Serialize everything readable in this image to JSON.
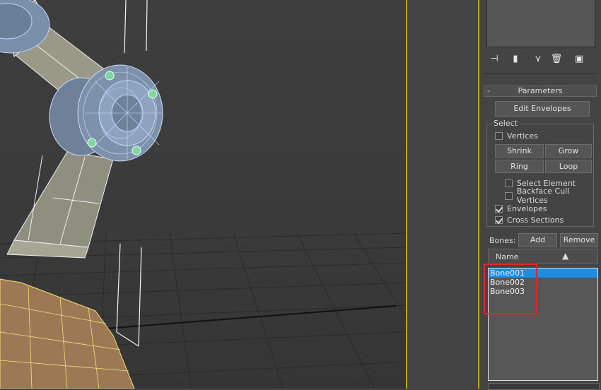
{
  "panel": {
    "rollout_title": "Parameters",
    "collapse_symbol": "-",
    "edit_envelopes": "Edit Envelopes",
    "select_group_label": "Select",
    "vertices": {
      "label": "Vertices",
      "checked": false
    },
    "shrink": "Shrink",
    "grow": "Grow",
    "ring": "Ring",
    "loop": "Loop",
    "select_element": {
      "label": "Select Element",
      "checked": false
    },
    "backface_cull": {
      "label": "Backface Cull Vertices",
      "checked": false
    },
    "envelopes": {
      "label": "Envelopes",
      "checked": true
    },
    "cross_sections": {
      "label": "Cross Sections",
      "checked": true
    },
    "bones_label": "Bones:",
    "add": "Add",
    "remove": "Remove",
    "name_header": "Name",
    "sort_arrow": "▲",
    "bones": [
      "Bone001",
      "Bone002",
      "Bone003"
    ],
    "selected_bone": "Bone001"
  },
  "toolbar": {
    "icons": [
      "pin-stack-icon",
      "show-end-result-icon",
      "make-unique-icon",
      "remove-modifier-icon",
      "configure-modifier-sets-icon"
    ]
  },
  "colors": {
    "highlight": "#1e8ce0",
    "viewport_border": "#b9a51e",
    "annotation_red": "#e2252f"
  }
}
